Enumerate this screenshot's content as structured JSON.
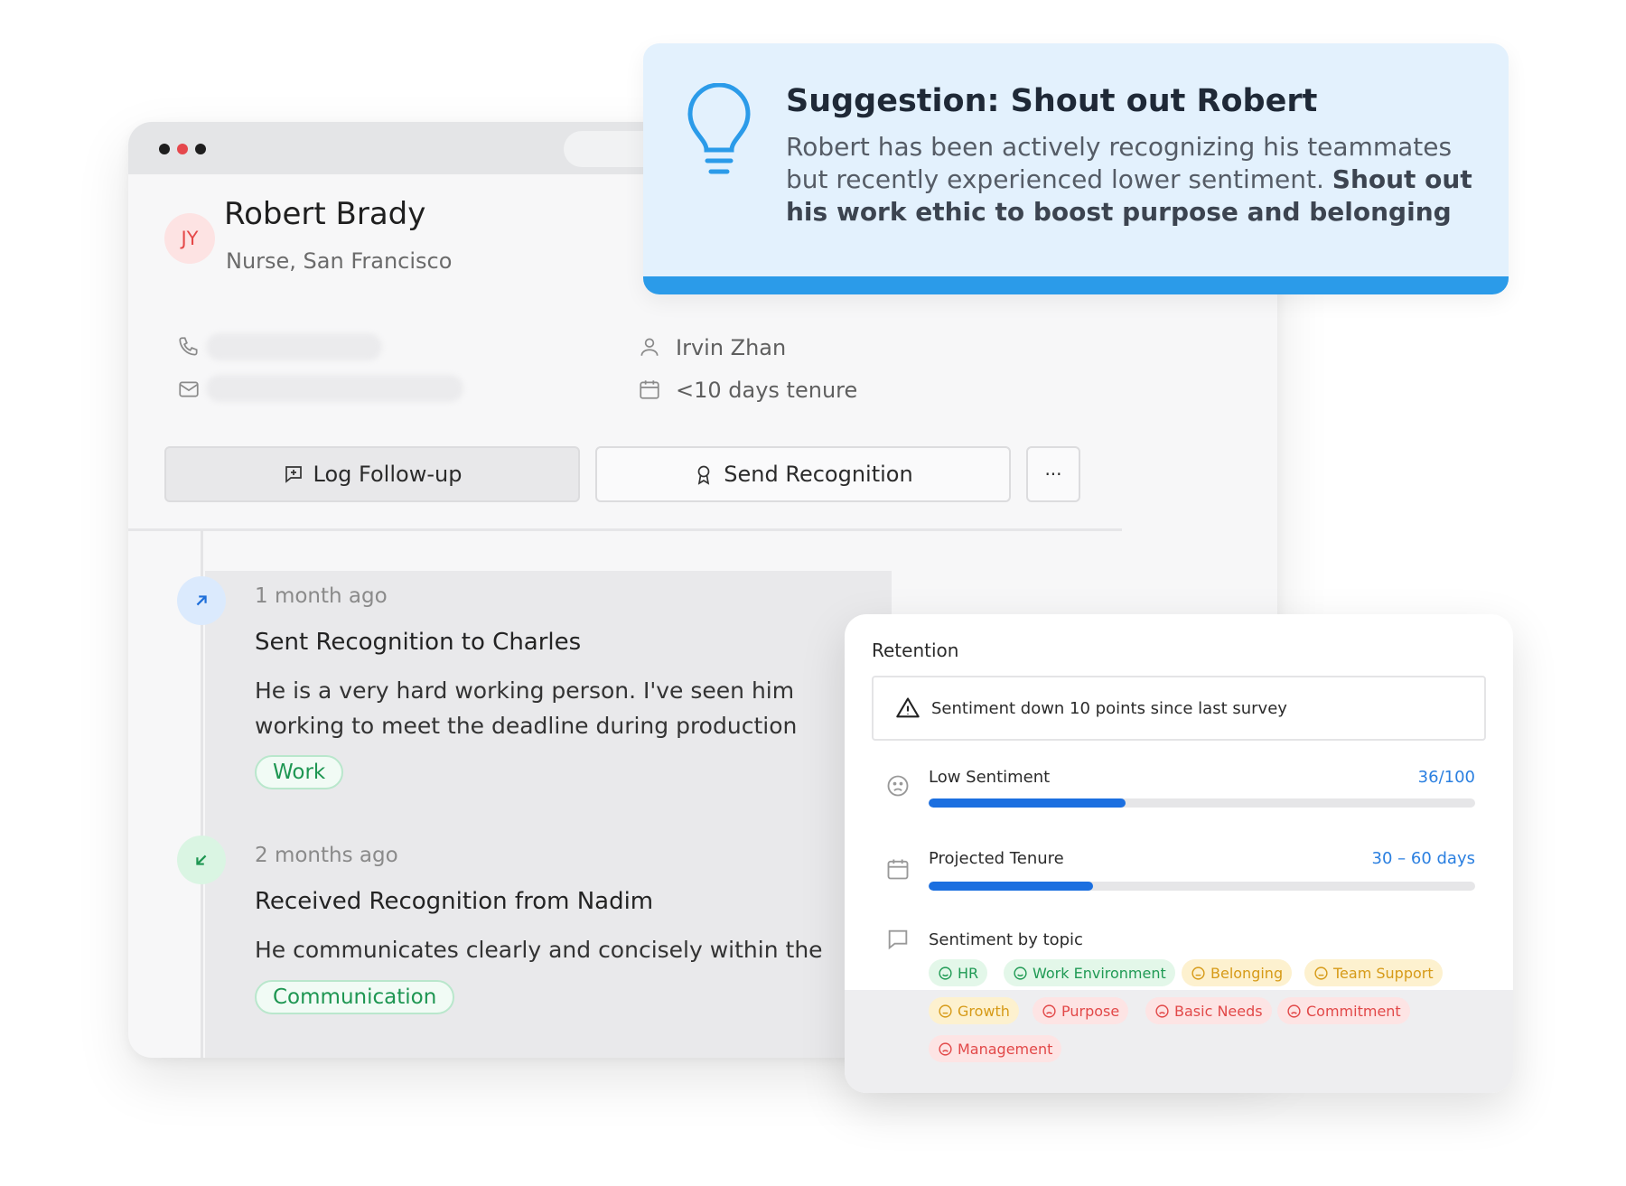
{
  "profile": {
    "initials": "JY",
    "name": "Robert Brady",
    "role": "Nurse, San Francisco",
    "manager": "Irvin Zhan",
    "tenure": "<10 days tenure"
  },
  "actions": {
    "log_followup": "Log Follow-up",
    "send_recognition": "Send Recognition",
    "more": "···"
  },
  "timeline": [
    {
      "ago": "1 month ago",
      "title": "Sent Recognition to Charles",
      "body": "He is a very hard working person. I've seen him working to meet the deadline during production releases.",
      "tag": "Work"
    },
    {
      "ago": "2 months ago",
      "title": "Received Recognition from Nadim",
      "body": "He communicates clearly and concisely within the team.",
      "tag": "Communication"
    }
  ],
  "suggestion": {
    "title": "Suggestion: Shout out Robert",
    "body": "Robert has been actively recognizing his teammates but recently experienced lower sentiment.",
    "highlight": "Shout out his work ethic to boost purpose and belonging"
  },
  "retention": {
    "title": "Retention",
    "alert": "Sentiment down 10 points since last survey",
    "metrics": [
      {
        "label": "Low Sentiment",
        "value": "36/100",
        "progress": 0.36
      },
      {
        "label": "Projected Tenure",
        "value": "30 – 60 days",
        "progress": 0.3
      }
    ],
    "topics_label": "Sentiment by topic",
    "topics": [
      {
        "label": "HR",
        "mood": "good"
      },
      {
        "label": "Work Environment",
        "mood": "good"
      },
      {
        "label": "Belonging",
        "mood": "neutral"
      },
      {
        "label": "Team Support",
        "mood": "neutral"
      },
      {
        "label": "Growth",
        "mood": "neutral"
      },
      {
        "label": "Purpose",
        "mood": "bad"
      },
      {
        "label": "Basic Needs",
        "mood": "bad"
      },
      {
        "label": "Commitment",
        "mood": "bad"
      },
      {
        "label": "Management",
        "mood": "bad"
      }
    ]
  },
  "colors": {
    "accent": "#2b9be9",
    "progress": "#1b6fe0",
    "positive": "#1f9a54",
    "neutral": "#d69a17",
    "negative": "#e24848"
  },
  "icons": [
    "phone-icon",
    "mail-icon",
    "user-icon",
    "calendar-icon",
    "message-plus-icon",
    "award-icon",
    "arrow-up-right-icon",
    "arrow-down-left-icon",
    "lightbulb-icon",
    "warning-icon",
    "sad-face-icon",
    "chat-bubble-icon"
  ]
}
